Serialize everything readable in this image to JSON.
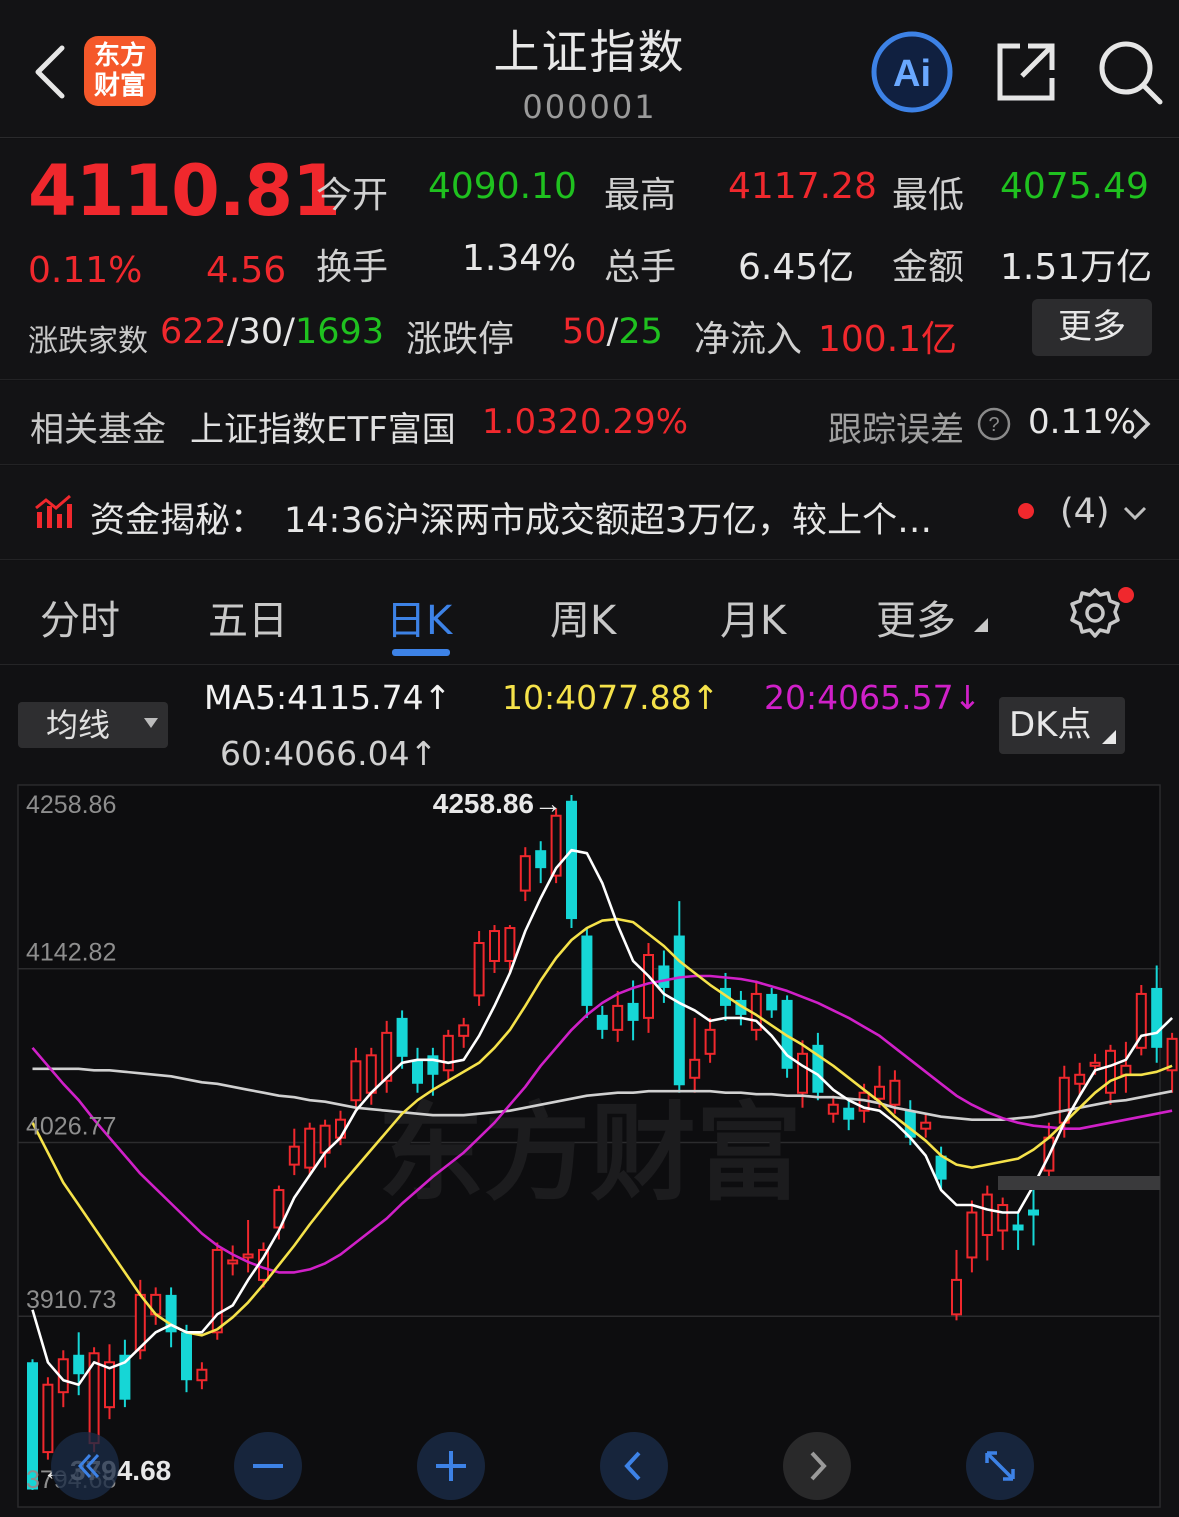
{
  "header": {
    "title": "上证指数",
    "code": "000001",
    "logo_line1": "东方",
    "logo_line2": "财富",
    "ai_label": "Ai"
  },
  "quote": {
    "price": "4110.81",
    "change_pct": "0.11%",
    "change": "4.56",
    "open_label": "今开",
    "open": "4090.10",
    "high_label": "最高",
    "high": "4117.28",
    "low_label": "最低",
    "low": "4075.49",
    "turnover_label": "换手",
    "turnover": "1.34%",
    "volume_label": "总手",
    "volume": "6.45亿",
    "amount_label": "金额",
    "amount": "1.51万亿",
    "breadth_label": "涨跌家数",
    "breadth_up": "622",
    "breadth_flat": "30",
    "breadth_down": "1693",
    "slash": "/",
    "limit_label": "涨跌停",
    "limit_up": "50",
    "limit_down": "25",
    "netflow_label": "净流入",
    "netflow": "100.1亿",
    "more_label": "更多"
  },
  "fund": {
    "label": "相关基金",
    "name": "上证指数ETF富国",
    "price": "1.032",
    "pct": "0.29%",
    "track_label": "跟踪误差",
    "track_value": "0.11%"
  },
  "news": {
    "label": "资金揭秘：",
    "text": "14:36沪深两市成交额超3万亿，较上个…",
    "count": "(4)"
  },
  "tabs": [
    {
      "label": "分时"
    },
    {
      "label": "五日"
    },
    {
      "label": "日K"
    },
    {
      "label": "周K"
    },
    {
      "label": "月K"
    },
    {
      "label": "更多"
    }
  ],
  "ma": {
    "select_label": "均线",
    "ma5": "MA5:4115.74",
    "ma10": "10:4077.88",
    "ma20": "20:4065.57",
    "ma60": "60:4066.04",
    "dk_label": "DK点",
    "up_arrow": "↑",
    "down_arrow": "↓"
  },
  "chart_data": {
    "type": "candlestick",
    "y_ticks": [
      "4258.86",
      "4142.82",
      "4026.77",
      "3910.73",
      "3794.68"
    ],
    "ylim": [
      3794.68,
      4258.86
    ],
    "max_label": "4258.86→",
    "min_label": "←3794.68",
    "watermark": "东方财富",
    "colors": {
      "up": "#f0282d",
      "down": "#16d6d6",
      "ma5": "#ffffff",
      "ma10": "#f5e24a",
      "ma20": "#d020c8",
      "ma60": "#d0d0d0"
    },
    "candles": [
      {
        "o": 3880,
        "c": 3795,
        "h": 3882,
        "l": 3794.68
      },
      {
        "o": 3820,
        "c": 3865,
        "h": 3870,
        "l": 3815
      },
      {
        "o": 3860,
        "c": 3882,
        "h": 3888,
        "l": 3850
      },
      {
        "o": 3885,
        "c": 3872,
        "h": 3900,
        "l": 3858
      },
      {
        "o": 3826,
        "c": 3886,
        "h": 3890,
        "l": 3820
      },
      {
        "o": 3850,
        "c": 3880,
        "h": 3892,
        "l": 3842
      },
      {
        "o": 3885,
        "c": 3855,
        "h": 3895,
        "l": 3850
      },
      {
        "o": 3888,
        "c": 3925,
        "h": 3935,
        "l": 3882
      },
      {
        "o": 3912,
        "c": 3925,
        "h": 3930,
        "l": 3905
      },
      {
        "o": 3925,
        "c": 3900,
        "h": 3930,
        "l": 3890
      },
      {
        "o": 3900,
        "c": 3868,
        "h": 3905,
        "l": 3860
      },
      {
        "o": 3868,
        "c": 3875,
        "h": 3880,
        "l": 3862
      },
      {
        "o": 3900,
        "c": 3955,
        "h": 3960,
        "l": 3895
      },
      {
        "o": 3946,
        "c": 3948,
        "h": 3958,
        "l": 3938
      },
      {
        "o": 3950,
        "c": 3952,
        "h": 3975,
        "l": 3940
      },
      {
        "o": 3935,
        "c": 3955,
        "h": 3960,
        "l": 3930
      },
      {
        "o": 3970,
        "c": 3995,
        "h": 3998,
        "l": 3962
      },
      {
        "o": 4012,
        "c": 4024,
        "h": 4036,
        "l": 4005
      },
      {
        "o": 4010,
        "c": 4036,
        "h": 4040,
        "l": 4005
      },
      {
        "o": 4020,
        "c": 4038,
        "h": 4042,
        "l": 4010
      },
      {
        "o": 4030,
        "c": 4042,
        "h": 4048,
        "l": 4025
      },
      {
        "o": 4055,
        "c": 4081,
        "h": 4090,
        "l": 4048
      },
      {
        "o": 4060,
        "c": 4085,
        "h": 4090,
        "l": 4052
      },
      {
        "o": 4068,
        "c": 4100,
        "h": 4108,
        "l": 4060
      },
      {
        "o": 4110,
        "c": 4084,
        "h": 4115,
        "l": 4076
      },
      {
        "o": 4082,
        "c": 4066,
        "h": 4090,
        "l": 4060
      },
      {
        "o": 4085,
        "c": 4072,
        "h": 4090,
        "l": 4058
      },
      {
        "o": 4075,
        "c": 4098,
        "h": 4102,
        "l": 4068
      },
      {
        "o": 4098,
        "c": 4105,
        "h": 4110,
        "l": 4090
      },
      {
        "o": 4125,
        "c": 4160,
        "h": 4168,
        "l": 4118
      },
      {
        "o": 4148,
        "c": 4168,
        "h": 4172,
        "l": 4140
      },
      {
        "o": 4148,
        "c": 4170,
        "h": 4172,
        "l": 4140
      },
      {
        "o": 4195,
        "c": 4218,
        "h": 4224,
        "l": 4188
      },
      {
        "o": 4222,
        "c": 4210,
        "h": 4228,
        "l": 4200
      },
      {
        "o": 4205,
        "c": 4245,
        "h": 4250,
        "l": 4200
      },
      {
        "o": 4255,
        "c": 4176,
        "h": 4258.86,
        "l": 4170
      },
      {
        "o": 4165,
        "c": 4118,
        "h": 4170,
        "l": 4110
      },
      {
        "o": 4112,
        "c": 4102,
        "h": 4118,
        "l": 4096
      },
      {
        "o": 4102,
        "c": 4118,
        "h": 4128,
        "l": 4094
      },
      {
        "o": 4120,
        "c": 4108,
        "h": 4135,
        "l": 4095
      },
      {
        "o": 4110,
        "c": 4152,
        "h": 4160,
        "l": 4100
      },
      {
        "o": 4145,
        "c": 4130,
        "h": 4155,
        "l": 4120
      },
      {
        "o": 4165,
        "c": 4065,
        "h": 4188,
        "l": 4060
      },
      {
        "o": 4070,
        "c": 4082,
        "h": 4110,
        "l": 4060
      },
      {
        "o": 4086,
        "c": 4102,
        "h": 4110,
        "l": 4080
      },
      {
        "o": 4130,
        "c": 4118,
        "h": 4140,
        "l": 4108
      },
      {
        "o": 4122,
        "c": 4112,
        "h": 4128,
        "l": 4105
      },
      {
        "o": 4102,
        "c": 4126,
        "h": 4135,
        "l": 4095
      },
      {
        "o": 4126,
        "c": 4115,
        "h": 4130,
        "l": 4110
      },
      {
        "o": 4122,
        "c": 4076,
        "h": 4125,
        "l": 4070
      },
      {
        "o": 4060,
        "c": 4086,
        "h": 4095,
        "l": 4050
      },
      {
        "o": 4092,
        "c": 4060,
        "h": 4100,
        "l": 4055
      },
      {
        "o": 4046,
        "c": 4052,
        "h": 4058,
        "l": 4040
      },
      {
        "o": 4050,
        "c": 4042,
        "h": 4055,
        "l": 4035
      },
      {
        "o": 4048,
        "c": 4060,
        "h": 4066,
        "l": 4040
      },
      {
        "o": 4056,
        "c": 4064,
        "h": 4078,
        "l": 4050
      },
      {
        "o": 4052,
        "c": 4068,
        "h": 4075,
        "l": 4046
      },
      {
        "o": 4048,
        "c": 4030,
        "h": 4055,
        "l": 4025
      },
      {
        "o": 4036,
        "c": 4040,
        "h": 4046,
        "l": 4030
      },
      {
        "o": 4018,
        "c": 4002,
        "h": 4024,
        "l": 3995
      },
      {
        "o": 3912,
        "c": 3935,
        "h": 3955,
        "l": 3908
      },
      {
        "o": 3950,
        "c": 3980,
        "h": 3988,
        "l": 3940
      },
      {
        "o": 3965,
        "c": 3992,
        "h": 3998,
        "l": 3948
      },
      {
        "o": 3968,
        "c": 3985,
        "h": 3990,
        "l": 3955
      },
      {
        "o": 3972,
        "c": 3968,
        "h": 3980,
        "l": 3955
      },
      {
        "o": 3982,
        "c": 3978,
        "h": 3996,
        "l": 3958
      },
      {
        "o": 4008,
        "c": 4030,
        "h": 4040,
        "l": 4000
      },
      {
        "o": 4040,
        "c": 4070,
        "h": 4078,
        "l": 4030
      },
      {
        "o": 4066,
        "c": 4072,
        "h": 4080,
        "l": 4058
      },
      {
        "o": 4078,
        "c": 4080,
        "h": 4086,
        "l": 4072
      },
      {
        "o": 4060,
        "c": 4088,
        "h": 4092,
        "l": 4052
      },
      {
        "o": 4072,
        "c": 4078,
        "h": 4094,
        "l": 4060
      },
      {
        "o": 4090,
        "c": 4126,
        "h": 4132,
        "l": 4085
      },
      {
        "o": 4130,
        "c": 4090,
        "h": 4145,
        "l": 4080
      },
      {
        "o": 4075,
        "c": 4096,
        "h": 4100,
        "l": 4060
      }
    ],
    "ma5": [
      3915,
      3880,
      3868,
      3865,
      3880,
      3876,
      3880,
      3890,
      3900,
      3905,
      3900,
      3900,
      3912,
      3918,
      3935,
      3950,
      3968,
      3990,
      4005,
      4020,
      4030,
      4048,
      4060,
      4070,
      4080,
      4082,
      4082,
      4080,
      4082,
      4098,
      4118,
      4140,
      4168,
      4190,
      4210,
      4222,
      4220,
      4200,
      4172,
      4148,
      4138,
      4126,
      4120,
      4115,
      4108,
      4110,
      4110,
      4108,
      4098,
      4085,
      4078,
      4072,
      4062,
      4055,
      4050,
      4048,
      4040,
      4030,
      4018,
      3995,
      3985,
      3985,
      3982,
      3980,
      3980,
      3998,
      4018,
      4040,
      4058,
      4075,
      4078,
      4082,
      4098,
      4100,
      4110
    ],
    "ma10": [
      4040,
      4020,
      4000,
      3985,
      3970,
      3955,
      3940,
      3925,
      3912,
      3905,
      3900,
      3898,
      3902,
      3910,
      3920,
      3932,
      3945,
      3958,
      3972,
      3985,
      3998,
      4010,
      4022,
      4034,
      4046,
      4055,
      4062,
      4068,
      4074,
      4080,
      4090,
      4102,
      4118,
      4135,
      4150,
      4162,
      4170,
      4175,
      4176,
      4174,
      4166,
      4158,
      4148,
      4140,
      4132,
      4125,
      4118,
      4112,
      4105,
      4098,
      4092,
      4085,
      4078,
      4070,
      4062,
      4054,
      4044,
      4036,
      4028,
      4018,
      4012,
      4010,
      4012,
      4014,
      4016,
      4022,
      4030,
      4040,
      4050,
      4060,
      4068,
      4072,
      4072,
      4074,
      4078
    ],
    "ma20": [
      4090,
      4078,
      4066,
      4055,
      4042,
      4030,
      4018,
      4006,
      3996,
      3986,
      3976,
      3966,
      3958,
      3952,
      3947,
      3943,
      3940,
      3940,
      3942,
      3946,
      3952,
      3960,
      3968,
      3976,
      3986,
      3995,
      4004,
      4012,
      4020,
      4030,
      4040,
      4052,
      4064,
      4078,
      4090,
      4102,
      4112,
      4120,
      4126,
      4130,
      4133,
      4135,
      4137,
      4138,
      4138,
      4137,
      4136,
      4134,
      4131,
      4128,
      4124,
      4120,
      4115,
      4110,
      4104,
      4098,
      4090,
      4082,
      4074,
      4066,
      4058,
      4052,
      4047,
      4043,
      4040,
      4038,
      4037,
      4036,
      4036,
      4038,
      4040,
      4042,
      4044,
      4046,
      4048
    ],
    "ma60": [
      4076,
      4076,
      4076,
      4076,
      4075,
      4075,
      4074,
      4073,
      4072,
      4071,
      4069,
      4067,
      4066,
      4064,
      4062,
      4060,
      4058,
      4057,
      4055,
      4054,
      4052,
      4050,
      4049,
      4048,
      4047,
      4046,
      4045,
      4045,
      4045,
      4046,
      4047,
      4048,
      4050,
      4052,
      4054,
      4056,
      4058,
      4059,
      4060,
      4060,
      4061,
      4061,
      4061,
      4061,
      4061,
      4060,
      4060,
      4059,
      4059,
      4058,
      4058,
      4057,
      4057,
      4056,
      4055,
      4053,
      4050,
      4048,
      4046,
      4044,
      4043,
      4042,
      4042,
      4042,
      4043,
      4044,
      4046,
      4048,
      4050,
      4052,
      4054,
      4055,
      4057,
      4059,
      4061
    ]
  }
}
